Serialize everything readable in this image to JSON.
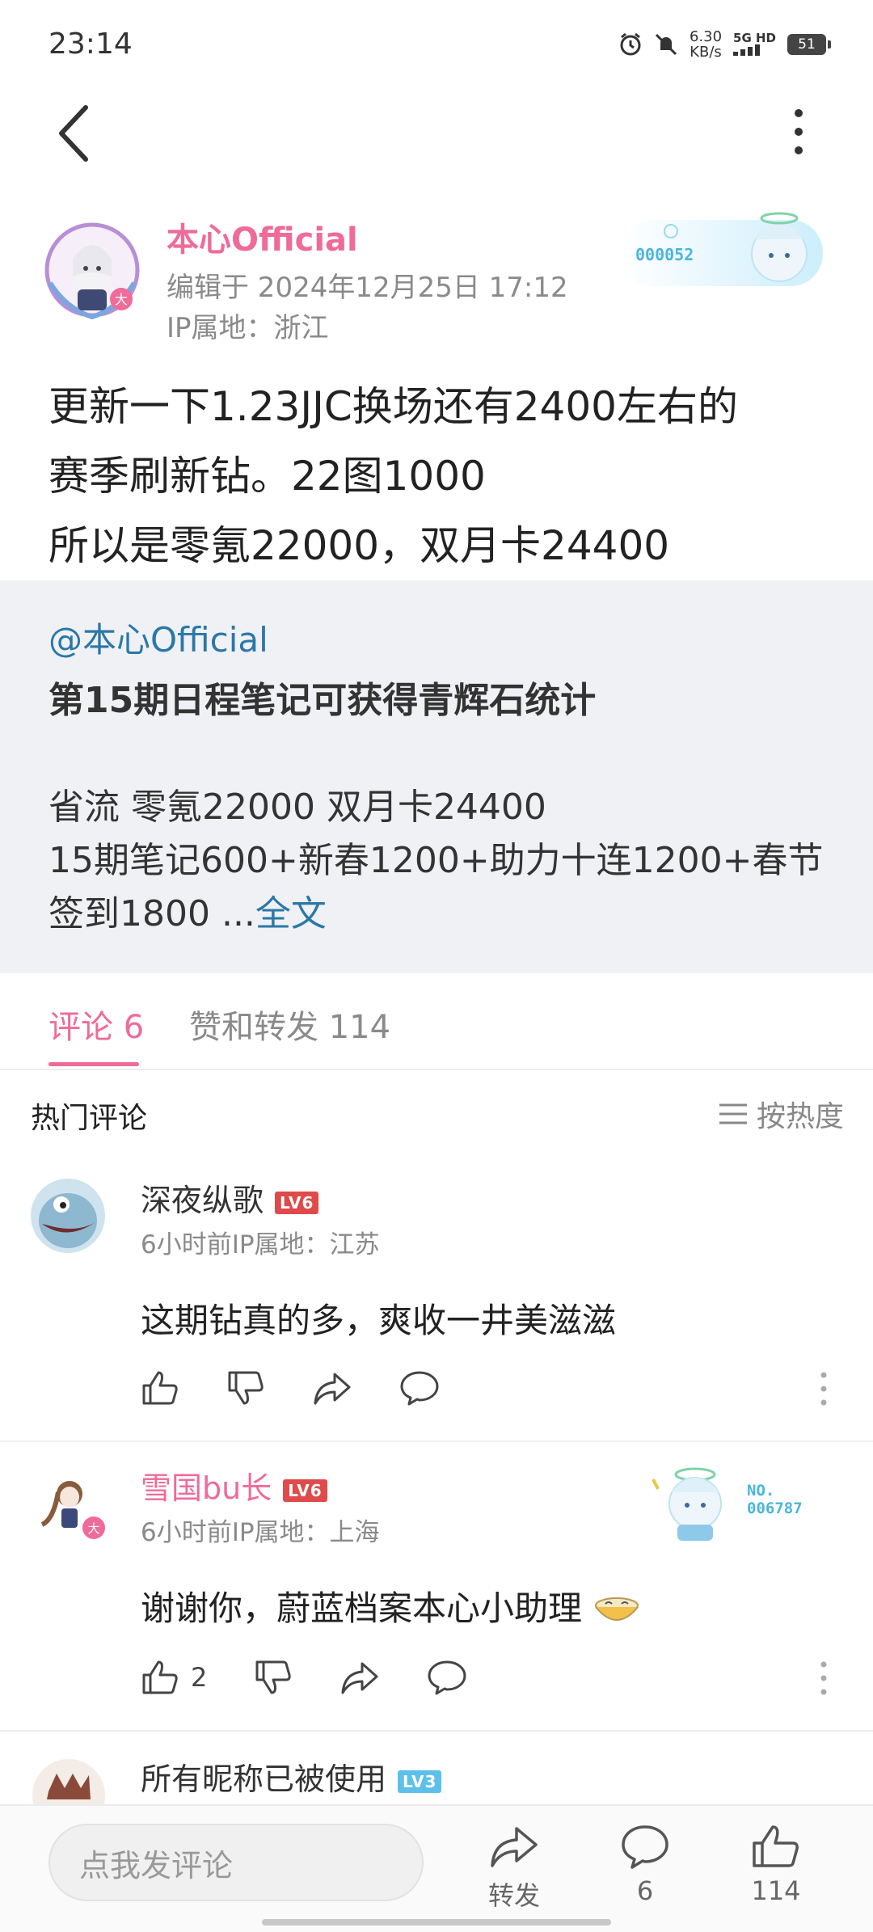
{
  "status_bar": {
    "time": "23:14",
    "net_speed_value": "6.30",
    "net_speed_unit": "KB/s",
    "net_type": "5G HD",
    "battery": "51",
    "icons": [
      "alarm-icon",
      "mute-icon",
      "signal-icon",
      "battery-icon"
    ]
  },
  "header": {
    "icons": [
      "back-arrow-icon",
      "more-vertical-icon"
    ]
  },
  "author": {
    "name": "本心Official",
    "edited": "编辑于 2024年12月25日 17:12",
    "ip": "IP属地：浙江",
    "badge_number": "000052"
  },
  "post": {
    "content": "更新一下1.23JJC换场还有2400左右的\n赛季刷新钻。22图1000\n所以是零氪22000，双月卡24400"
  },
  "quote": {
    "mention": "@本心Official",
    "title": "第15期日程笔记可获得青辉石统计",
    "line1": "省流 零氪22000   双月卡24400",
    "line2": "15期笔记600+新春1200+助力十连1200+春节签到1800 ...",
    "more_link": "全文"
  },
  "tabs": {
    "comments": "评论 6",
    "likes_reposts": "赞和转发 114"
  },
  "section": {
    "hot_label": "热门评论",
    "sort_label": "按热度"
  },
  "comments": [
    {
      "name": "深夜纵歌",
      "level": "LV6",
      "meta": "6小时前IP属地：江苏",
      "text": "这期钻真的多，爽收一井美滋滋",
      "likes": ""
    },
    {
      "name": "雪国bu长",
      "level": "LV6",
      "meta": "6小时前IP属地：上海",
      "text": "谢谢你，蔚蓝档案本心小助理",
      "likes": "2",
      "badge_label": "NO.",
      "badge_number": "006787"
    },
    {
      "name": "所有昵称已被使用",
      "level": "LV3"
    }
  ],
  "bottom_bar": {
    "input_placeholder": "点我发评论",
    "repost_label": "转发",
    "comment_count": "6",
    "like_count": "114"
  },
  "colors": {
    "accent_pink": "#ee6b9a",
    "link_blue": "#2a78a8",
    "level_red": "#e04a4a",
    "level_blue": "#5cc0ea"
  }
}
